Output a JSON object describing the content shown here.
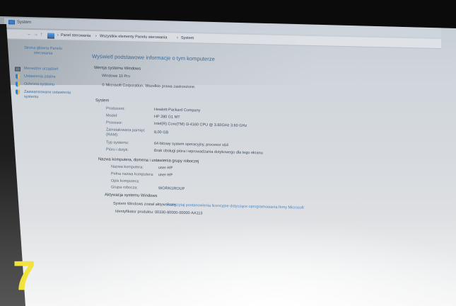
{
  "window": {
    "title": "System"
  },
  "nav": {
    "back_glyph": "←",
    "forward_glyph": "→",
    "up_glyph": "↑",
    "separator": "›",
    "breadcrumbs": [
      "Panel sterowania",
      "Wszystkie elementy Panelu sterowania",
      "System"
    ],
    "location_icon": "computer-icon"
  },
  "sidebar": {
    "home_link": "Strona główna Panelu sterowania",
    "items": [
      {
        "label": "Menedżer urządzeń",
        "icon": "device-manager-icon"
      },
      {
        "label": "Ustawienia zdalne",
        "icon": "shield-icon"
      },
      {
        "label": "Ochrona systemu",
        "icon": "shield-icon"
      },
      {
        "label": "Zaawansowane ustawienia systemu",
        "icon": "shield-icon"
      }
    ]
  },
  "main": {
    "heading": "Wyświetl podstawowe informacje o tym komputerze",
    "edition": {
      "title": "Wersja systemu Windows",
      "name": "Windows 10 Pro",
      "copyright": "© Microsoft Corporation. Wszelkie prawa zastrzeżone."
    },
    "system": {
      "title": "System",
      "rows": [
        {
          "label": "Producent:",
          "value": "Hewlett-Packard Company"
        },
        {
          "label": "Model:",
          "value": "HP 280 G1 MT"
        },
        {
          "label": "Procesor:",
          "value": "Intel(R) Core(TM) i3-4160 CPU @ 3.60GHz   3.60 GHz"
        },
        {
          "label": "Zainstalowana pamięć (RAM):",
          "value": "8,00 GB"
        },
        {
          "label": "Typ systemu:",
          "value": "64-bitowy system operacyjny, procesor x64"
        },
        {
          "label": "Pióro i dotyk:",
          "value": "Brak obsługi pióra i wprowadzania dotykowego dla tego ekranu"
        }
      ]
    },
    "computer_name": {
      "title": "Nazwa komputera, domena i ustawienia grupy roboczej",
      "rows": [
        {
          "label": "Nazwa komputera:",
          "value": "user-HP"
        },
        {
          "label": "Pełna nazwa komputera:",
          "value": "user-HP"
        },
        {
          "label": "Opis komputera:"
        },
        {
          "label": "Grupa robocza:",
          "value": "WORKGROUP"
        }
      ]
    },
    "activation": {
      "title": "Aktywacja systemu Windows",
      "status": "System Windows został aktywowany",
      "license_link": "Przeczytaj postanowienia licencyjne dotyczące oprogramowania firmy Microsoft",
      "product_id": "Identyfikator produktu: 00330-80000-00000-AA113"
    }
  },
  "photo_overlay": {
    "number": "7"
  },
  "colors": {
    "link": "#3d6fa8",
    "heading": "#3c6a98",
    "text": "#4f5f72",
    "overlay": "#f2e23c"
  }
}
